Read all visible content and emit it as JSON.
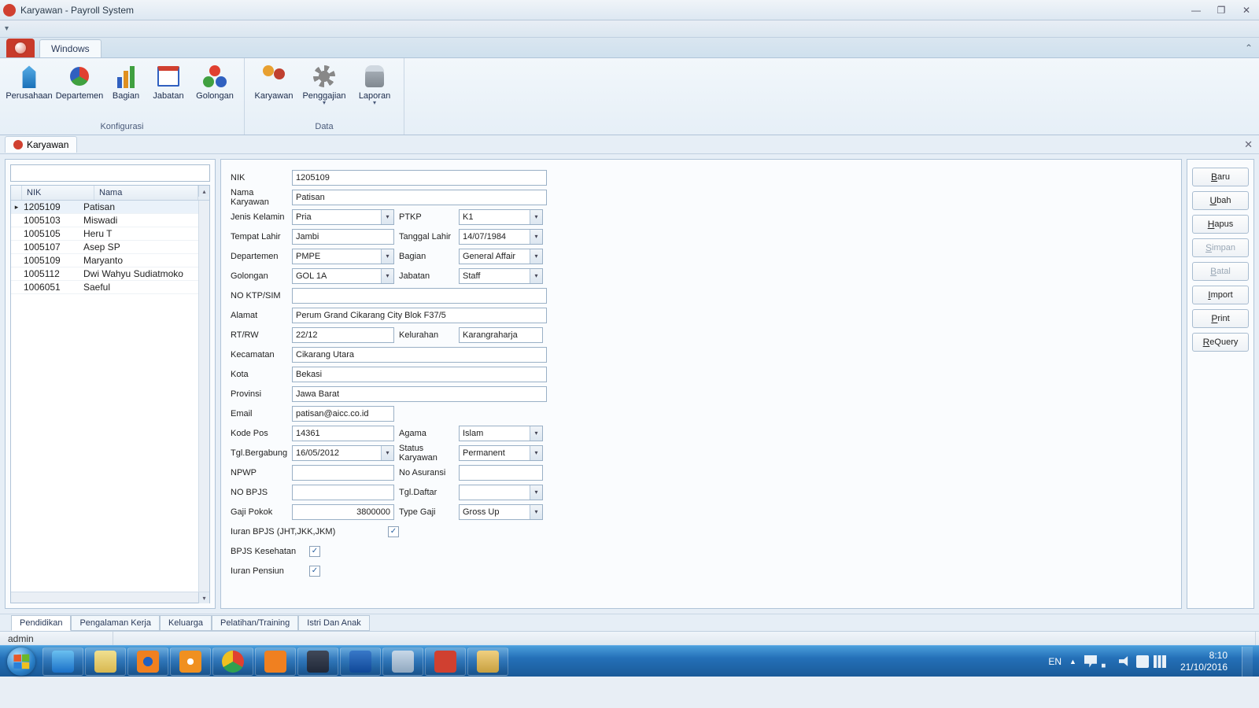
{
  "window": {
    "title": "Karyawan - Payroll System"
  },
  "ribbon": {
    "tab": "Windows",
    "groups": [
      {
        "title": "Konfigurasi",
        "items": [
          "Perusahaan",
          "Departemen",
          "Bagian",
          "Jabatan",
          "Golongan"
        ]
      },
      {
        "title": "Data",
        "items": [
          "Karyawan",
          "Penggajian",
          "Laporan"
        ]
      }
    ]
  },
  "doctab": "Karyawan",
  "grid": {
    "headers": {
      "nik": "NIK",
      "nama": "Nama"
    },
    "rows": [
      {
        "nik": "1205109",
        "nama": "Patisan",
        "selected": true
      },
      {
        "nik": "1005103",
        "nama": "Miswadi"
      },
      {
        "nik": "1005105",
        "nama": "Heru T"
      },
      {
        "nik": "1005107",
        "nama": "Asep SP"
      },
      {
        "nik": "1005109",
        "nama": "Maryanto"
      },
      {
        "nik": "1005112",
        "nama": "Dwi Wahyu Sudiatmoko"
      },
      {
        "nik": "1006051",
        "nama": "Saeful"
      }
    ]
  },
  "form": {
    "labels": {
      "nik": "NIK",
      "nama": "Nama Karyawan",
      "jk": "Jenis Kelamin",
      "ptkp": "PTKP",
      "tmplahir": "Tempat Lahir",
      "tgllahir": "Tanggal Lahir",
      "dept": "Departemen",
      "bagian": "Bagian",
      "gol": "Golongan",
      "jabatan": "Jabatan",
      "noktp": "NO KTP/SIM",
      "alamat": "Alamat",
      "rtrw": "RT/RW",
      "kel": "Kelurahan",
      "kec": "Kecamatan",
      "kota": "Kota",
      "prov": "Provinsi",
      "email": "Email",
      "kodepos": "Kode Pos",
      "agama": "Agama",
      "tgljoin": "Tgl.Bergabung",
      "status": "Status Karyawan",
      "npwp": "NPWP",
      "noasuransi": "No Asuransi",
      "nobpjs": "NO BPJS",
      "tgldaftar": "Tgl.Daftar",
      "gaji": "Gaji Pokok",
      "typegaji": "Type Gaji",
      "iuranbpjs": "Iuran BPJS (JHT,JKK,JKM)",
      "bpjskes": "BPJS Kesehatan",
      "iuranpensiun": "Iuran Pensiun"
    },
    "values": {
      "nik": "1205109",
      "nama": "Patisan",
      "jk": "Pria",
      "ptkp": "K1",
      "tmplahir": "Jambi",
      "tgllahir": "14/07/1984",
      "dept": "PMPE",
      "bagian": "General Affair",
      "gol": "GOL 1A",
      "jabatan": "Staff",
      "noktp": "",
      "alamat": "Perum Grand Cikarang City Blok F37/5",
      "rtrw": "22/12",
      "kel": "Karangraharja",
      "kec": "Cikarang Utara",
      "kota": "Bekasi",
      "prov": "Jawa Barat",
      "email": "patisan@aicc.co.id",
      "kodepos": "14361",
      "agama": "Islam",
      "tgljoin": "16/05/2012",
      "status": "Permanent",
      "npwp": "",
      "noasuransi": "",
      "nobpjs": "",
      "tgldaftar": "",
      "gaji": "3800000",
      "typegaji": "Gross Up",
      "iuranbpjs": true,
      "bpjskes": true,
      "iuranpensiun": true
    }
  },
  "actions": [
    "Baru",
    "Ubah",
    "Hapus",
    "Simpan",
    "Batal",
    "Import",
    "Print",
    "ReQuery"
  ],
  "actions_disabled": [
    "Simpan",
    "Batal"
  ],
  "bottom_tabs": [
    "Pendidikan",
    "Pengalaman Kerja",
    "Keluarga",
    "Pelatihan/Training",
    "Istri Dan Anak"
  ],
  "statusbar": {
    "user": "admin"
  },
  "taskbar": {
    "lang": "EN",
    "time": "8:10",
    "date": "21/10/2016",
    "apps": [
      "explorer-ie",
      "file-explorer",
      "firefox",
      "media-player",
      "chrome",
      "xampp",
      "putty",
      "thunderbird",
      "mail",
      "app-red",
      "paint"
    ]
  }
}
